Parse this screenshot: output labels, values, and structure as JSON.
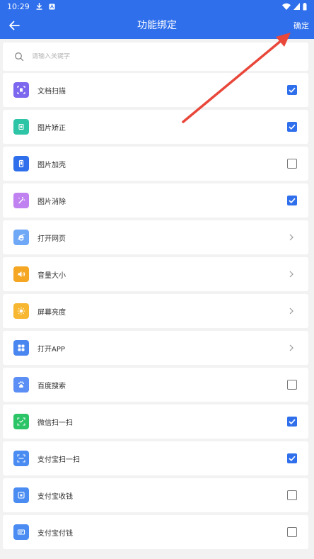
{
  "status_bar": {
    "time": "10:29"
  },
  "toolbar": {
    "title": "功能绑定",
    "confirm_label": "确定"
  },
  "search": {
    "placeholder": "请输入关键字"
  },
  "colors": {
    "accent": "#2f6fec",
    "annotation_arrow": "#e8473a"
  },
  "items": [
    {
      "label": "文档扫描",
      "icon": "document-scan-icon",
      "color": "#7b68ee",
      "control": "checkbox",
      "checked": true
    },
    {
      "label": "图片矫正",
      "icon": "image-correct-icon",
      "color": "#2ec4a6",
      "control": "checkbox",
      "checked": true
    },
    {
      "label": "图片加壳",
      "icon": "phone-shell-icon",
      "color": "#2f6fec",
      "control": "checkbox",
      "checked": false
    },
    {
      "label": "图片消除",
      "icon": "magic-wand-icon",
      "color": "#c082f0",
      "control": "checkbox",
      "checked": true
    },
    {
      "label": "打开网页",
      "icon": "browser-icon",
      "color": "#6fa8f7",
      "control": "chevron"
    },
    {
      "label": "音量大小",
      "icon": "volume-icon",
      "color": "#f5a623",
      "control": "chevron"
    },
    {
      "label": "屏幕亮度",
      "icon": "brightness-icon",
      "color": "#f7b731",
      "control": "chevron"
    },
    {
      "label": "打开APP",
      "icon": "apps-grid-icon",
      "color": "#4a86f0",
      "control": "chevron"
    },
    {
      "label": "百度搜索",
      "icon": "baidu-icon",
      "color": "#5b8ff5",
      "control": "checkbox",
      "checked": false
    },
    {
      "label": "微信扫一扫",
      "icon": "wechat-scan-icon",
      "color": "#2bc467",
      "control": "checkbox",
      "checked": true
    },
    {
      "label": "支付宝扫一扫",
      "icon": "alipay-scan-icon",
      "color": "#4a8cf2",
      "control": "checkbox",
      "checked": true
    },
    {
      "label": "支付宝收钱",
      "icon": "alipay-receive-icon",
      "color": "#4a8cf2",
      "control": "checkbox",
      "checked": false
    },
    {
      "label": "支付宝付钱",
      "icon": "alipay-pay-icon",
      "color": "#4a8cf2",
      "control": "checkbox",
      "checked": false
    }
  ]
}
